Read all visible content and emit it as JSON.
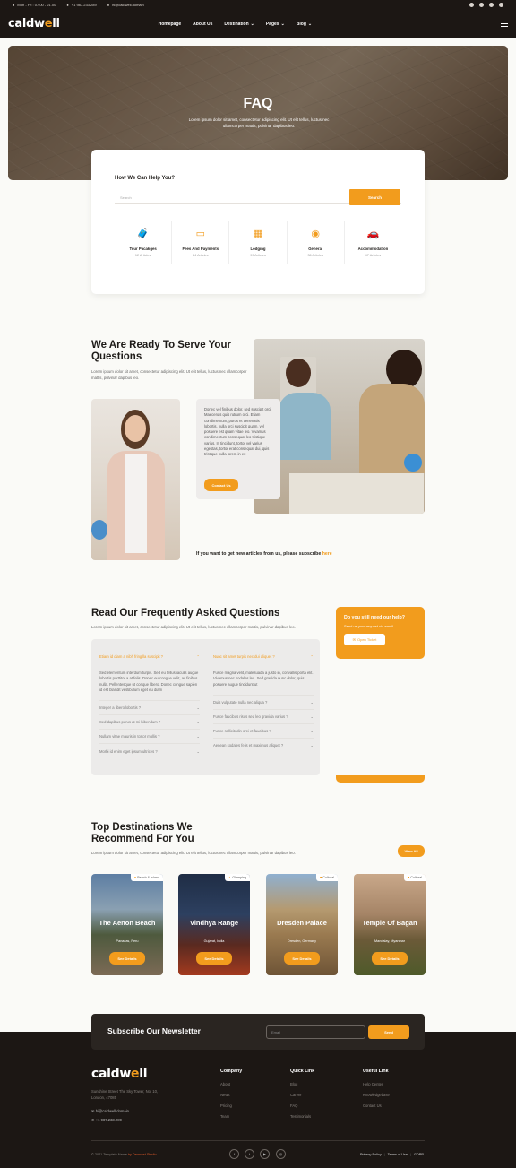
{
  "topbar": {
    "hours": "Mon - Fri : 07.00 - 21.00",
    "phone": "+1 987.233.289",
    "email": "hi@caldwell.domain"
  },
  "nav": {
    "logo_a": "caldw",
    "logo_b": "e",
    "logo_c": "ll",
    "items": [
      "Homepage",
      "About Us",
      "Destination",
      "Pages",
      "Blog"
    ]
  },
  "hero": {
    "title": "FAQ",
    "text": "Lorem ipsum dolor sit amet, consectetur adipiscing elit. Ut elit tellus, luctus nec ullamcorper mattis, pulvinar dapibus leo."
  },
  "help": {
    "title": "How We Can Help You?",
    "placeholder": "Search",
    "button": "Search",
    "cats": [
      {
        "t": "Tour Pacakges",
        "s": "12 Articles",
        "icon": "suitcase-icon"
      },
      {
        "t": "Fees And Payments",
        "s": "24 Articles",
        "icon": "credit-card-icon"
      },
      {
        "t": "Lodging",
        "s": "99 Articles",
        "icon": "hotel-icon"
      },
      {
        "t": "General",
        "s": "36 Articles",
        "icon": "info-icon"
      },
      {
        "t": "Accommodation",
        "s": "47 Articles",
        "icon": "car-icon"
      }
    ]
  },
  "serve": {
    "title": "We Are Ready To Serve Your Questions",
    "text": "Lorem ipsum dolor sit amet, consectetur adipiscing elit. Ut elit tellus, luctus nec ullamcorper mattis, pulvinar dapibus leo.",
    "quote": "Donec vel finibus dolor, sed suscipit orci. Maecenas quis rutrum orci. Etiam condimentum, purus et venenatis lobortis, nulla orci suscipit quam, vel posuere est quam vitae leo. Vivamus condimentum consequat leo tristique varius. In tincidunt, tortor vel varius egestas, tortor erat consequat dui, quis tristique nulla lorem in ex",
    "contact": "Contact Us",
    "subscribe": "If you want to get new articles from us, please subscribe",
    "here": "here"
  },
  "faq": {
    "title": "Read Our Frequently Asked Questions",
    "text": "Lorem ipsum dolor sit amet, consectetur adipiscing elit. Ut elit tellus, luctus nec ullamcorper mattis, pulvinar dapibus leo.",
    "left_open_q": "Etiam id diam a nibh fringilla suscipit ?",
    "left_open_a": "Sed elementum interdum turpis. Sed eu tellus iaculis augue lobortis porttitor a at felis. Donec eu congue velit, ac finibus nulla. Pellentesque ut conque libero. Donec congue sapien id est blandit vestibulum eget eu diam",
    "left_q": [
      "Integer a libero lobortis ?",
      "Sed dapibus purus at mi bibendum ?",
      "Nullam vitae mauris in tortor mollis ?",
      "Morbi id enim eget ipsum ultrices ?"
    ],
    "right_open_q": "Nunc sit amet turpis nec dui aliquet ?",
    "right_open_a": "Fusce magna velit, malesuada a justo in, convallis porta elit. Vivamus nec sodales leo. Sed gravida nunc dolor, quis posuere augue tincidunt ut",
    "right_q": [
      "Duis vulputate nulla nec aliqua ?",
      "Fusce faucibus risus sed leo gravida varius ?",
      "Fusce sollicitudin orci et faucibus ?",
      "Aenean sodales felis et maximus aliquet ?"
    ],
    "need_title": "Do you still need our help?",
    "need_text": "Send us your request via email",
    "ticket": "Open Ticket"
  },
  "dest": {
    "title": "Top Destinations We Recommend For You",
    "text": "Lorem ipsum dolor sit amet, consectetur adipiscing elit. Ut elit tellus, luctus nec ullamcorper mattis, pulvinar dapibus leo.",
    "viewall": "View All",
    "details": "See Details",
    "cards": [
      {
        "tag": "Beach & Island",
        "name": "The Aenon Beach",
        "sub": "Panacas, Peru"
      },
      {
        "tag": "Glamping",
        "name": "Vindhya Range",
        "sub": "Gujarat, India"
      },
      {
        "tag": "Cultural",
        "name": "Dresden Palace",
        "sub": "Dresden, Germany"
      },
      {
        "tag": "Cultural",
        "name": "Temple Of Bagan",
        "sub": "Mandalay, Myanmar"
      }
    ]
  },
  "newsletter": {
    "title": "Subscribe Our Newsletter",
    "placeholder": "Email",
    "button": "Send"
  },
  "footer": {
    "address": "Sunshine Street The Sky Tower, No. 10, London, 47085",
    "email": "hi@caldwell.domain",
    "phone": "+1 987.233.289",
    "company_title": "Company",
    "company": [
      "About",
      "News",
      "Pricing",
      "Team"
    ],
    "quick_title": "Quick Link",
    "quick": [
      "Blog",
      "Career",
      "FAQ",
      "Testimonials"
    ],
    "useful_title": "Useful Link",
    "useful": [
      "Help Center",
      "Knowledgebase",
      "Contact Us"
    ],
    "copy": "© 2021 Template Name",
    "by": "by Dewnust Studio",
    "legal": [
      "Privacy Policy",
      "Terms of Use",
      "GDPR"
    ]
  },
  "colors": {
    "accent": "#f29c1d",
    "dark": "#1c1714"
  }
}
